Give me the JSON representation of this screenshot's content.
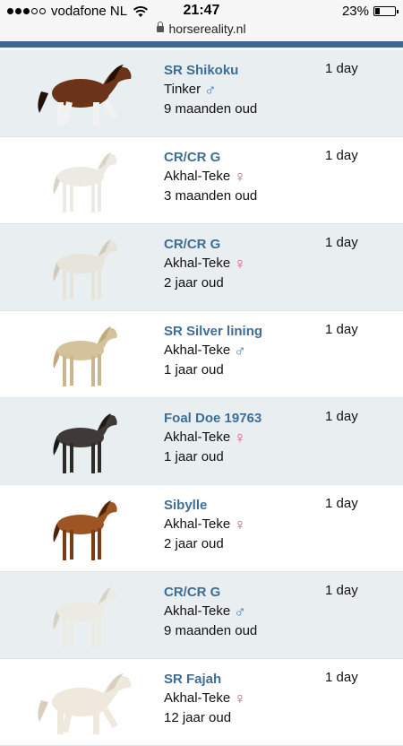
{
  "status_bar": {
    "carrier": "vodafone NL",
    "time": "21:47",
    "battery": "23%",
    "battery_level": 0.23
  },
  "url_bar": {
    "domain": "horsereality.nl"
  },
  "horses": [
    {
      "name": "SR Shikoku",
      "breed": "Tinker",
      "sex": "male",
      "sex_symbol": "♂",
      "age": "9 maanden oud",
      "time": "1 day",
      "coat": "#6b3418",
      "mane": "#201008",
      "legs": "#f2f2f2",
      "pose": "adult"
    },
    {
      "name": "CR/CR G",
      "breed": "Akhal-Teke",
      "sex": "female",
      "sex_symbol": "♀",
      "age": "3 maanden oud",
      "time": "1 day",
      "coat": "#ecebe3",
      "mane": "#d6d3c7",
      "legs": "#ecebe3",
      "pose": "foal"
    },
    {
      "name": "CR/CR G",
      "breed": "Akhal-Teke",
      "sex": "female",
      "sex_symbol": "♀",
      "age": "2 jaar oud",
      "time": "1 day",
      "coat": "#e7e4dc",
      "mane": "#cfcabd",
      "legs": "#e7e4dc",
      "pose": "foal"
    },
    {
      "name": "SR Silver lining",
      "breed": "Akhal-Teke",
      "sex": "male",
      "sex_symbol": "♂",
      "age": "1 jaar oud",
      "time": "1 day",
      "coat": "#d4c29b",
      "mane": "#bfa97c",
      "legs": "#cbb78d",
      "pose": "foal"
    },
    {
      "name": "Foal Doe 19763",
      "breed": "Akhal-Teke",
      "sex": "female",
      "sex_symbol": "♀",
      "age": "1 jaar oud",
      "time": "1 day",
      "coat": "#3f3a37",
      "mane": "#1c1a19",
      "legs": "#2e2a28",
      "pose": "foal"
    },
    {
      "name": "Sibylle",
      "breed": "Akhal-Teke",
      "sex": "female",
      "sex_symbol": "♀",
      "age": "2 jaar oud",
      "time": "1 day",
      "coat": "#9c5523",
      "mane": "#4a230d",
      "legs": "#7b3d16",
      "pose": "foal"
    },
    {
      "name": "CR/CR G",
      "breed": "Akhal-Teke",
      "sex": "male",
      "sex_symbol": "♂",
      "age": "9 maanden oud",
      "time": "1 day",
      "coat": "#ecebe3",
      "mane": "#d4d1c5",
      "legs": "#ecebe3",
      "pose": "foal"
    },
    {
      "name": "SR Fajah",
      "breed": "Akhal-Teke",
      "sex": "female",
      "sex_symbol": "♀",
      "age": "12 jaar oud",
      "time": "1 day",
      "coat": "#efe8dc",
      "mane": "#d9cfbf",
      "legs": "#efe8dc",
      "pose": "adult"
    }
  ]
}
